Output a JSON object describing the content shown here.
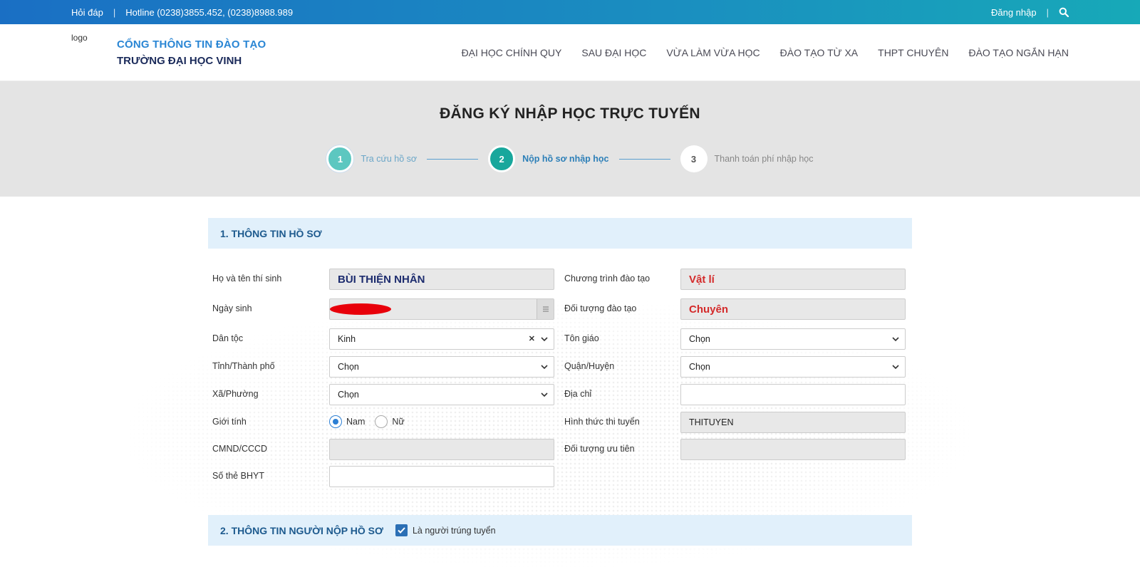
{
  "topbar": {
    "faq": "Hỏi đáp",
    "hotline": "Hotline (0238)3855.452, (0238)8988.989",
    "login": "Đăng nhập"
  },
  "header": {
    "logo_alt": "logo",
    "brand_line1": "CỔNG THÔNG TIN ĐÀO TẠO",
    "brand_line2": "TRƯỜNG ĐẠI HỌC VINH",
    "nav": [
      "ĐẠI HỌC CHÍNH QUY",
      "SAU ĐẠI HỌC",
      "VỪA LÀM VỪA HỌC",
      "ĐÀO TẠO TỪ XA",
      "THPT CHUYÊN",
      "ĐÀO TẠO NGẮN HẠN"
    ]
  },
  "banner": {
    "title": "ĐĂNG KÝ NHẬP HỌC TRỰC TUYẾN",
    "steps": [
      {
        "number": "1",
        "label": "Tra cứu hồ sơ"
      },
      {
        "number": "2",
        "label": "Nộp hồ sơ nhập học"
      },
      {
        "number": "3",
        "label": "Thanh toán phí nhập học"
      }
    ]
  },
  "section1": {
    "title": "1. THÔNG TIN HỒ SƠ",
    "labels": {
      "full_name": "Họ và tên thí sinh",
      "program": "Chương trình đào tạo",
      "dob": "Ngày sinh",
      "target": "Đối tượng đào tạo",
      "ethnicity": "Dân tộc",
      "religion": "Tôn giáo",
      "province": "Tỉnh/Thành phố",
      "district": "Quận/Huyện",
      "ward": "Xã/Phường",
      "address": "Địa chỉ",
      "gender": "Giới tính",
      "exam_form": "Hình thức thi tuyển",
      "id_card": "CMND/CCCD",
      "priority": "Đối tượng ưu tiên",
      "insurance": "Số thẻ BHYT"
    },
    "values": {
      "full_name": "BÙI THIỆN NHÂN",
      "program": "Vật lí",
      "target": "Chuyên",
      "ethnicity": "Kinh",
      "religion": "Chọn",
      "province": "Chọn",
      "district": "Chọn",
      "ward": "Chọn",
      "exam_form": "THITUYEN"
    },
    "gender_options": {
      "male": "Nam",
      "female": "Nữ",
      "selected": "Nam"
    }
  },
  "section2": {
    "title": "2. THÔNG TIN NGƯỜI NỘP HỒ SƠ",
    "checkbox_label": "Là người trúng tuyển",
    "checked": true
  },
  "colors": {
    "accent": "#2c7fd4",
    "step_active": "#18a79c",
    "value_red": "#d42a2a",
    "value_navy": "#1d2c6e"
  }
}
